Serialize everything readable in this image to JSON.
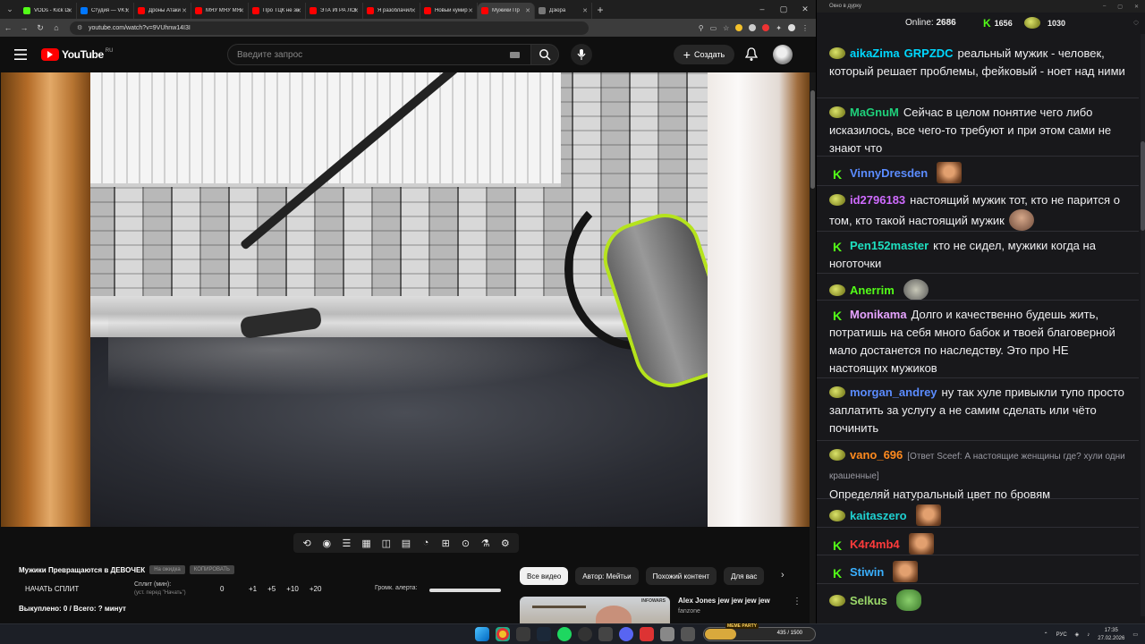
{
  "browser": {
    "tabs": [
      {
        "label": "VODs - Kick Dash",
        "color": "#53fc18"
      },
      {
        "label": "Студия — VK Live",
        "color": "#0077ff"
      },
      {
        "label": "Дроны Атаки",
        "color": "#ff0000"
      },
      {
        "label": "МЯУ МЯУ МЯУ",
        "color": "#ff0000"
      },
      {
        "label": "Про ТЦК не зна",
        "color": "#ff0000"
      },
      {
        "label": "ЭТА ИГРА ЛОМ",
        "color": "#ff0000"
      },
      {
        "label": "Я разоблачил",
        "color": "#ff0000"
      },
      {
        "label": "Новый кумир",
        "color": "#ff0000"
      },
      {
        "label": "Мужики Пр",
        "color": "#ff0000",
        "active": true
      },
      {
        "label": "Дзюра",
        "color": "#777777"
      }
    ],
    "url": "youtube.com/watch?v=9VUhnw14I3I"
  },
  "youtube": {
    "logo_text": "YouTube",
    "region": "RU",
    "search_placeholder": "Введите запрос",
    "create_label": "Создать"
  },
  "split": {
    "title": "Мужики Превращаются в ДЕВОЧЕК",
    "btn_no_wait": "На ожидка",
    "btn_copy": "КОПИРОВАТЬ",
    "start_label": "НАЧАТЬ СПЛИТ",
    "minutes_label": "Сплит (мин):",
    "minutes_sub": "(уст. перед \"Начать\")",
    "value": "0",
    "increments": [
      "+1",
      "+5",
      "+10",
      "+20"
    ],
    "alert_volume_label": "Громк. алерта:",
    "bought_label": "Выкуплено: 0 / Всего: ? минут"
  },
  "related": {
    "chips": [
      "Все видео",
      "Автор: Мейтьи",
      "Похожий контент",
      "Для вас"
    ],
    "video_title": "Alex Jones jew jew jew jew",
    "channel": "fanzone",
    "thumb_tag": "INFOWARS"
  },
  "chat": {
    "window_title": "Окно в дурку",
    "online_label": "Online:",
    "online_count": "2686",
    "kick_count": "1656",
    "points_count": "1030",
    "messages": [
      {
        "badge": "pepe",
        "user": "aikaZima",
        "color": "#00d8ff",
        "mention": "GRPZDC",
        "text": "реальный мужик - человек, который решает проблемы, фейковый - ноет над ними"
      },
      {
        "badge": "pepe",
        "user": "MaGnuM",
        "color": "#1fd17b",
        "text": "Сейчас в целом понятие чего либо исказилось, все чего-то требуют и при этом сами не знают что"
      },
      {
        "badge": "kick",
        "user": "VinnyDresden",
        "color": "#5b8cff",
        "text": "",
        "emote": "face"
      },
      {
        "badge": "pepe",
        "user": "id2796183",
        "color": "#cf6bff",
        "text": "настоящий мужик тот, кто не парится о том, кто такой настоящий мужик",
        "emote": "guy"
      },
      {
        "badge": "kick",
        "user": "Pen152master",
        "color": "#1fe0c0",
        "text": "кто не сидел, мужики когда на ноготочки"
      },
      {
        "badge": "pepe",
        "user": "Anerrim",
        "color": "#53fc18",
        "text": "",
        "emote": "bubble"
      },
      {
        "badge": "kick",
        "user": "Monikama",
        "color": "#e6a3ff",
        "text": "Долго и качественно будешь жить, потратишь на себя много бабок и твоей благоверной мало достанется по наследству. Это про НЕ настоящих мужиков"
      },
      {
        "badge": "pepe",
        "user": "morgan_andrey",
        "color": "#5b8cff",
        "text": "ну так хуле привыкли тупо просто заплатить за услугу а не самим сделать или чёто починить"
      },
      {
        "badge": "pepe",
        "user": "vano_696",
        "color": "#ff8a1e",
        "reply": "[Ответ Sceef: А настоящие женщины где? хули одни крашенные]",
        "text": "Определяй натуральный цвет по бровям"
      },
      {
        "badge": "pepe",
        "user": "kaitaszero",
        "color": "#1fd1d1",
        "text": "",
        "emote": "face"
      },
      {
        "badge": "kick",
        "user": "K4r4mb4",
        "color": "#ff3b3b",
        "text": "",
        "emote": "face"
      },
      {
        "badge": "kick",
        "user": "Stiwin",
        "color": "#3ab0ff",
        "text": "",
        "emote": "face"
      },
      {
        "badge": "pepe",
        "user": "Selkus",
        "color": "#9bd86a",
        "text": "",
        "emote": "pepe2"
      }
    ]
  },
  "taskbar": {
    "meme_label": "MEME PARTY",
    "meme_count": "435 / 1500",
    "meme_progress": 0.29,
    "lang": "РУС",
    "time": "17:35",
    "date": "27.02.2026"
  }
}
